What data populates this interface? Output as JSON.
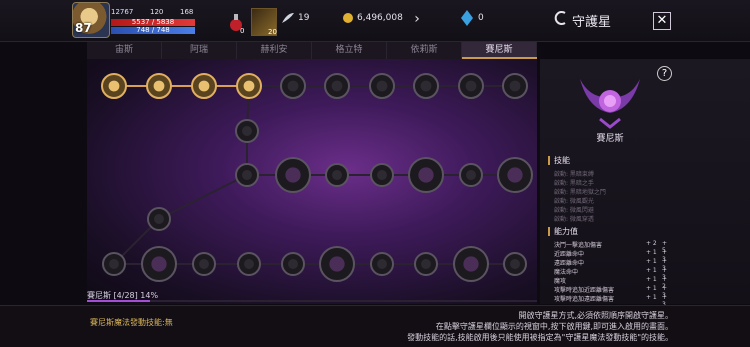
{
  "hud": {
    "level": "87",
    "stat_a": "12767",
    "stat_b": "120",
    "stat_c": "168",
    "hp": "5537 / 5838",
    "mp": "748 / 748",
    "potion_count": "0",
    "item_count": "20",
    "feather_count": "19",
    "gold": "6,496,008",
    "gem_count": "0",
    "title": "守護星"
  },
  "tabs": [
    {
      "label": "宙斯",
      "active": false
    },
    {
      "label": "阿瑞",
      "active": false
    },
    {
      "label": "赫利安",
      "active": false
    },
    {
      "label": "格立特",
      "active": false
    },
    {
      "label": "依莉斯",
      "active": false
    },
    {
      "label": "賽尼斯",
      "active": true
    }
  ],
  "progress": {
    "label": "賽尼斯 [4/28] 14%",
    "fraction": 0.14
  },
  "detail": {
    "name": "賽尼斯",
    "skills_title": "技能",
    "skills": [
      "啟動: 黑暗束缚",
      "啟動: 黑暗之手",
      "啟動: 黑暗地獄之門",
      "啟動: 微風觀光",
      "啟動: 微風閃避",
      "啟動: 微風穿透"
    ],
    "stats_title": "能力值",
    "stats": [
      {
        "name": "決鬥一擊追加傷害",
        "v1": "+ 2",
        "v2": "+ 5"
      },
      {
        "name": "近距離命中",
        "v1": "+ 1",
        "v2": "+ 3"
      },
      {
        "name": "遠距離命中",
        "v1": "+ 1",
        "v2": "+ 3"
      },
      {
        "name": "魔法命中",
        "v1": "+ 1",
        "v2": "+ 3"
      },
      {
        "name": "魔攻",
        "v1": "+ 1",
        "v2": "+ 2"
      },
      {
        "name": "攻擊時追加近距離傷害",
        "v1": "+ 1",
        "v2": "+ 3"
      },
      {
        "name": "攻擊時追加遠距離傷害",
        "v1": "+ 1",
        "v2": "+ 3"
      }
    ]
  },
  "status_text": "賽尼斯魔法發動技能:無",
  "help_lines": [
    "開啟守護星方式,必須依照順序開啟守護星。",
    "在點擊守護星欄位顯示的視窗中,按下啟用鍵,即可進入啟用的畫面。",
    "發動技能的話,技能啟用後只能使用被指定為\"守護星魔法發動技能\"的技能。"
  ],
  "colors": {
    "accent": "#c99a4a",
    "progress": "#a24fd6",
    "hp": "#e03a3a",
    "mp": "#4b7ee6"
  }
}
